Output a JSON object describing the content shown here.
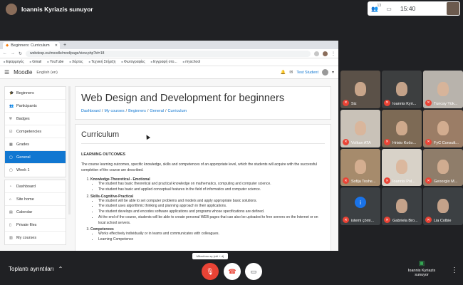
{
  "meet": {
    "presenter_banner": "Ioannis Kyriazis sunuyor",
    "participant_count": "13",
    "time": "15:40",
    "meeting_details": "Toplantı ayrıntıları",
    "window_tooltip": "Mikrofonu aç (ctrl + d)",
    "present_label_1": "Ioannis Kyriazis",
    "present_label_2": "sunuyor"
  },
  "browser": {
    "tab_title": "Beginners: Curriculum",
    "url": "webdesp.eu/moodle/mod/page/view.php?id=18",
    "bookmarks": [
      "Εφαρμογές",
      "Gmail",
      "YouTube",
      "Χάρτες",
      "Τεχνική Στήριξη",
      "Φωτογραφίες",
      "Εγγραφή στο...",
      "myschool"
    ]
  },
  "moodle": {
    "brand": "Moodle",
    "language": "English (en)",
    "user": "Test Student",
    "sidebar_course": [
      {
        "label": "Beginners",
        "icon": "graduation-cap-icon"
      },
      {
        "label": "Participants",
        "icon": "users-icon"
      },
      {
        "label": "Badges",
        "icon": "shield-icon"
      },
      {
        "label": "Competencies",
        "icon": "check-square-icon"
      },
      {
        "label": "Grades",
        "icon": "table-icon"
      },
      {
        "label": "General",
        "icon": "folder-icon"
      },
      {
        "label": "Week 1",
        "icon": "folder-icon"
      }
    ],
    "sidebar_site": [
      {
        "label": "Dashboard",
        "icon": "tachometer-icon"
      },
      {
        "label": "Site home",
        "icon": "home-icon"
      },
      {
        "label": "Calendar",
        "icon": "calendar-icon"
      },
      {
        "label": "Private files",
        "icon": "file-icon"
      },
      {
        "label": "My courses",
        "icon": "courses-icon"
      }
    ],
    "course_title": "Web Design and Development for beginners",
    "breadcrumb": [
      "Dashboard",
      "My courses",
      "Beginners",
      "General",
      "Curriculum"
    ],
    "page_title": "Curriculum",
    "section_heading": "LEARNING OUTCOMES",
    "intro": "The course learning outcomes, specific knowledge, skills and competences of an appropriate level, which the students will acquire with the successful completion of the course are described.",
    "outcomes": [
      {
        "title": "Knowledge-Theoretical - Emotional",
        "items": [
          "The student has basic theoretical and practical knowledge on mathematics, computing and computer science.",
          "The student has basic and applied conceptual features in the field of informatics and computer science."
        ]
      },
      {
        "title": "Skills-Cognitive-Practical",
        "items": [
          "The student will be able to set computer problems and models and apply appropriate basic solutions.",
          "The student uses algorithmic thinking and planning approach in their applications.",
          "The student develops and encodes software applications and programs whose specifications are defined.",
          "At the end of the course, students will be able to create personal WEB pages that can also be uploaded to free servers on the Internet or on local school servers."
        ]
      },
      {
        "title": "Competences",
        "items": [
          "Works effectively individually or in teams and communicates with colleagues.",
          "Learning Competence"
        ]
      }
    ]
  },
  "participants": [
    {
      "name": "Siz",
      "bg": "#5b5148"
    },
    {
      "name": "Ioannis Kyri...",
      "bg": "#3d3f40"
    },
    {
      "name": "Tuncay Yük...",
      "bg": "#b8b3ac"
    },
    {
      "name": "Volkan ATA",
      "bg": "#c9c2b8"
    },
    {
      "name": "Hristo Kočo...",
      "bg": "#7d6a55"
    },
    {
      "name": "FyC Consult...",
      "bg": "#9b7d66"
    },
    {
      "name": "Sofija Toshe...",
      "bg": "#a68b6c"
    },
    {
      "name": "Ioannis Pol...",
      "bg": "#d8d2c8"
    },
    {
      "name": "Geoorgio M...",
      "bg": "#8f7d6a"
    },
    {
      "name": "istemi çömi...",
      "bg": "#3c4043",
      "initial": "i"
    },
    {
      "name": "Gabriela Bro...",
      "bg": "#3c4043"
    },
    {
      "name": "Lia Colbie",
      "bg": "#3c4043"
    }
  ]
}
